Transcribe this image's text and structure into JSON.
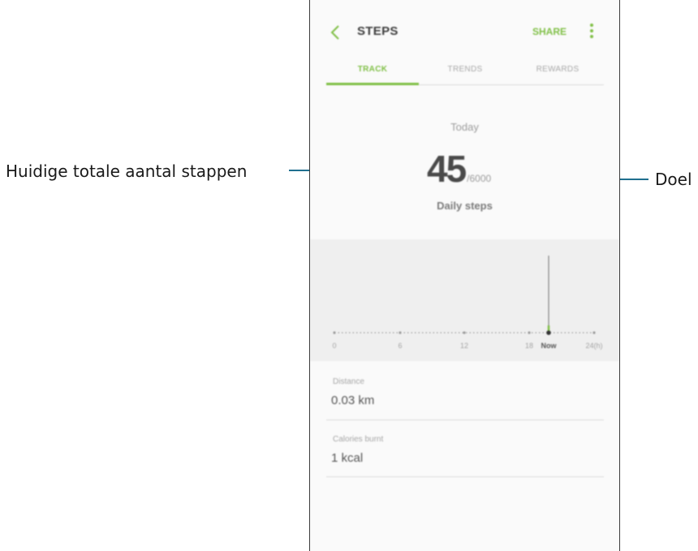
{
  "callouts": {
    "left": "Huidige totale aantal stappen",
    "right": "Doel"
  },
  "app": {
    "title": "STEPS",
    "share": "SHARE",
    "tabs": [
      "TRACK",
      "TRENDS",
      "REWARDS"
    ],
    "active_tab": "TRACK"
  },
  "summary": {
    "date_label": "Today",
    "steps": "45",
    "goal": "/6000",
    "caption": "Daily steps"
  },
  "graph": {
    "x_labels": [
      "0",
      "6",
      "12",
      "18",
      "Now",
      "24(h)"
    ]
  },
  "stats": [
    {
      "label": "Distance",
      "value": "0.03 km"
    },
    {
      "label": "Calories burnt",
      "value": "1 kcal"
    }
  ],
  "colors": {
    "accent": "#7fbf45",
    "callout_line": "#1f6f8f"
  }
}
